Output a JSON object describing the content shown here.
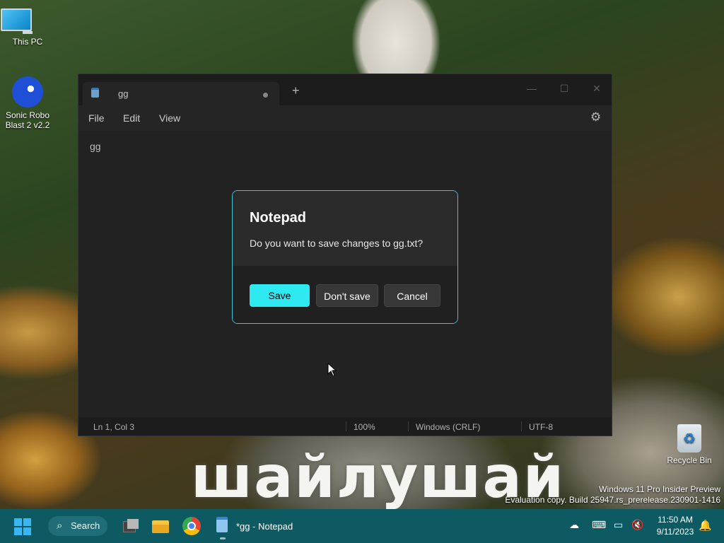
{
  "desktop": {
    "icons": [
      {
        "label": "This PC"
      },
      {
        "label": "Sonic Robo Blast 2 v2.2"
      },
      {
        "label": "Recycle Bin"
      }
    ],
    "wallpaper_text": "шайлушай",
    "watermark": {
      "line1": "Windows 11 Pro Insider Preview",
      "line2": "Evaluation copy. Build 25947.rs_prerelease.230901-1416"
    }
  },
  "notepad": {
    "tab_title": "gg",
    "new_tab_symbol": "+",
    "window_controls": {
      "minimize": "—",
      "maximize": "☐",
      "close": "✕"
    },
    "menu": {
      "file": "File",
      "edit": "Edit",
      "view": "View"
    },
    "editor_text": "gg",
    "status": {
      "position": "Ln 1, Col 3",
      "zoom": "100%",
      "line_ending": "Windows (CRLF)",
      "encoding": "UTF-8"
    }
  },
  "dialog": {
    "title": "Notepad",
    "message": "Do you want to save changes to gg.txt?",
    "buttons": {
      "save": "Save",
      "dont_save": "Don't save",
      "cancel": "Cancel"
    },
    "accent": "#2ee8f2"
  },
  "taskbar": {
    "search_label": "Search",
    "active_app_label": "*gg - Notepad",
    "clock": {
      "time": "11:50 AM",
      "date": "9/11/2023"
    },
    "color": "#0e5a63"
  }
}
